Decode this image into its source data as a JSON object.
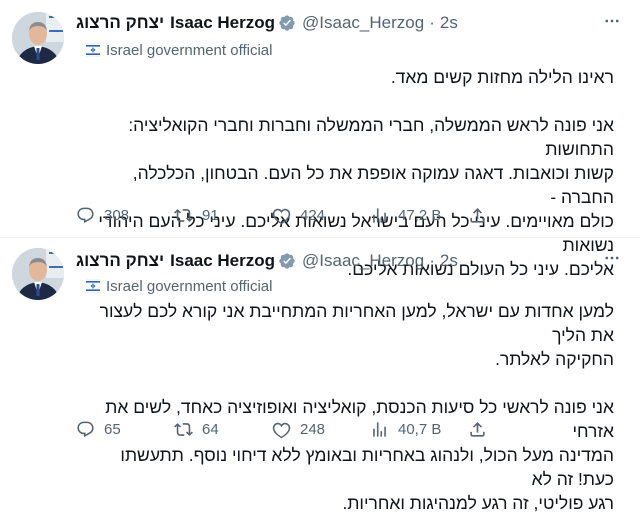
{
  "tweets": [
    {
      "author_he": "יצחק הרצוג",
      "author_en": "Isaac Herzog",
      "handle": "@Isaac_Herzog",
      "separator": "·",
      "time": "2s",
      "label": "Israel government official",
      "paragraphs": [
        [
          "ראינו הלילה מחזות קשים מאד."
        ],
        [
          "אני פונה לראש הממשלה, חברי הממשלה וחברות וחברי הקואליציה: התחושות",
          "קשות וכואבות. דאגה עמוקה אופפת את כל העם. הבטחון, הכלכלה, החברה -",
          "כולם מאויימים. עיני כל העם בישראל נשואות אליכם. עיני כל העם היהודי נשואות",
          "אליכם. עיני כל העולם נשואות אליכם."
        ]
      ],
      "stats": {
        "replies": "308",
        "retweets": "91",
        "likes": "424",
        "views": "47,2 B"
      }
    },
    {
      "author_he": "יצחק הרצוג",
      "author_en": "Isaac Herzog",
      "handle": "@Isaac_Herzog",
      "separator": "·",
      "time": "2s",
      "label": "Israel government official",
      "paragraphs": [
        [
          "למען אחדות עם ישראל, למען האחריות המתחייבת אני קורא לכם לעצור את הליך",
          "החקיקה לאלתר."
        ],
        [
          "אני פונה לראשי כל סיעות הכנסת, קואליציה ואופוזיציה כאחד, לשים את אזרחי",
          "המדינה מעל הכול, ולנהוג באחריות ובאומץ ללא דיחוי נוסף. תתעשתו כעת! זה לא",
          "רגע פוליטי, זה רגע למנהיגות ואחריות."
        ]
      ],
      "stats": {
        "replies": "65",
        "retweets": "64",
        "likes": "248",
        "views": "40,7 B"
      }
    }
  ],
  "colors": {
    "verified": "#1d9bf0",
    "gray": "#536471",
    "text": "#0f1419"
  }
}
